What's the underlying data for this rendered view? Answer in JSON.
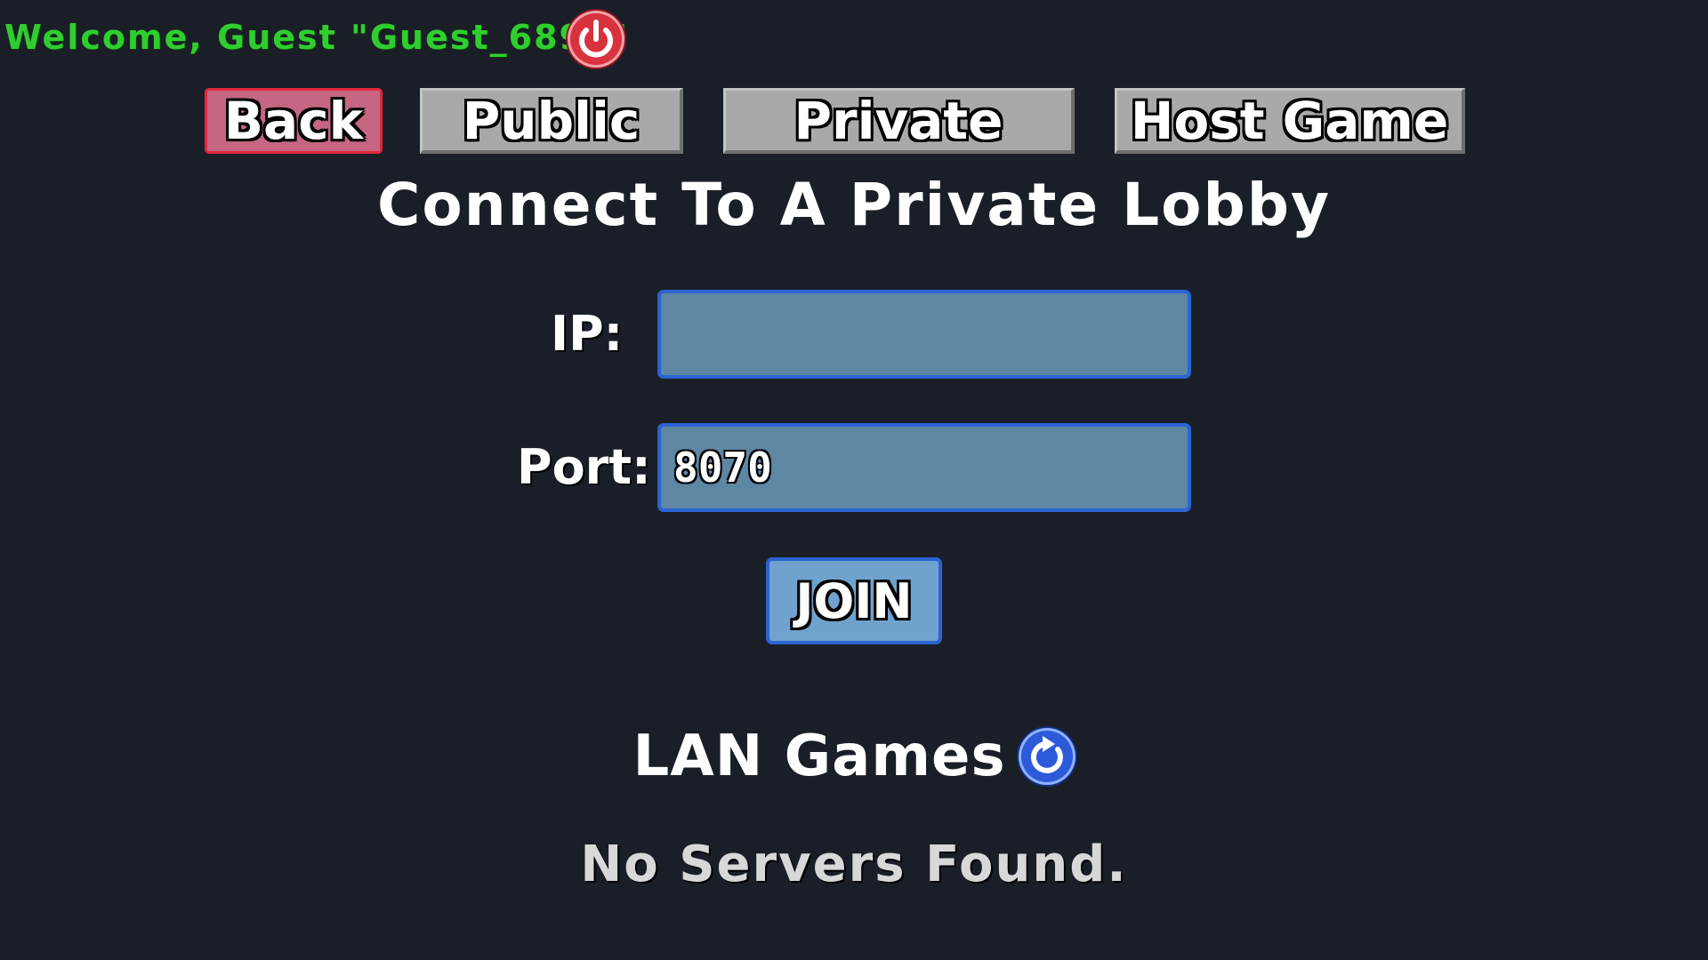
{
  "header": {
    "welcome_text": "Welcome, Guest \"Guest_6895\"",
    "power_icon": "power-icon"
  },
  "tabs": {
    "back_label": "Back",
    "public_label": "Public",
    "private_label": "Private",
    "host_label": "Host Game"
  },
  "connect": {
    "title": "Connect To A Private Lobby",
    "ip_label": "IP:",
    "ip_value": "",
    "port_label": "Port:",
    "port_value": "8070",
    "join_label": "JOIN"
  },
  "lan": {
    "title": "LAN Games",
    "refresh_icon": "refresh-icon",
    "status": "No Servers Found."
  },
  "colors": {
    "background": "#1a1e27",
    "welcome_green": "#2fce2f",
    "back_button": "#c66682",
    "tab_gray": "#a9a9a9",
    "field_blue": "#5e87a4",
    "join_blue": "#6fa3cd",
    "accent_border": "#2c63d3",
    "power_red": "#d8323e",
    "refresh_blue": "#2d5ad8"
  }
}
